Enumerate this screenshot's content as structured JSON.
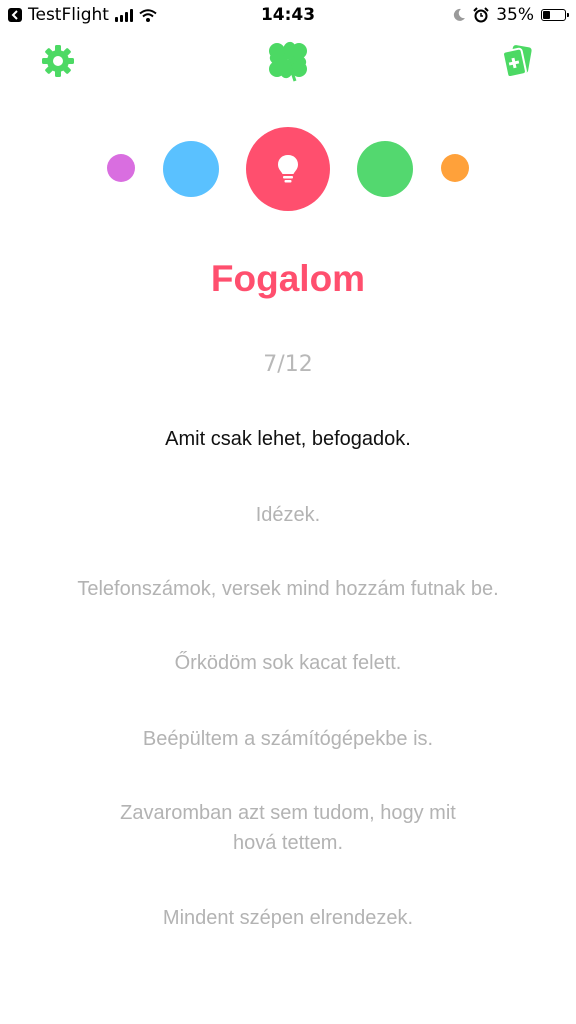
{
  "status_bar": {
    "back_app": "TestFlight",
    "time": "14:43",
    "battery_percent": "35%",
    "battery_level": 0.35
  },
  "nav": {
    "left_icon": "gear-icon",
    "center_icon": "clover-icon",
    "right_icon": "cards-add-icon"
  },
  "colors": {
    "accent_green": "#4cd964",
    "purple": "#d96ee0",
    "blue": "#5ac1ff",
    "red": "#ff4f6e",
    "green": "#53d86f",
    "orange": "#ffa13a"
  },
  "category": {
    "title": "Fogalom",
    "icon": "lightbulb-icon"
  },
  "progress": {
    "counter": "7/12"
  },
  "lines": [
    "Amit csak lehet, befogadok.",
    "Idézek.",
    "Telefonszámok, versek mind hozzám futnak be.",
    "Őrködöm sok kacat felett.",
    "Beépültem a számítógépekbe is.",
    "Zavaromban azt sem tudom, hogy mit\nhová tettem.",
    "Mindent szépen elrendezek."
  ]
}
